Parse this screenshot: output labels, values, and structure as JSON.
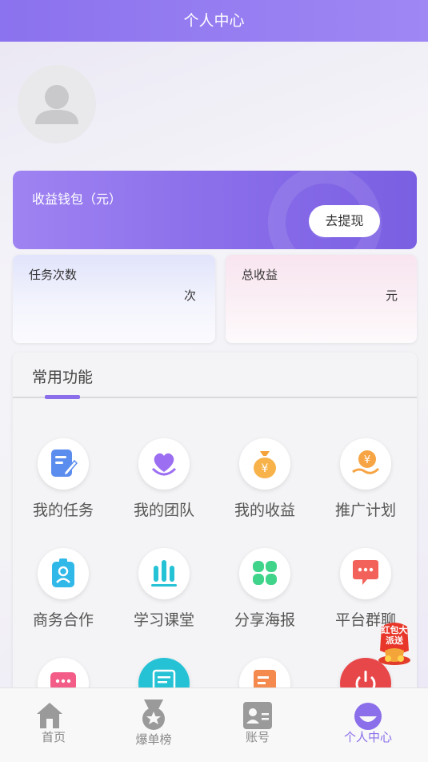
{
  "header": {
    "title": "个人中心"
  },
  "wallet": {
    "label": "收益钱包（元）",
    "withdraw_label": "去提现"
  },
  "stats": {
    "tasks": {
      "label": "任务次数",
      "unit": "次"
    },
    "income": {
      "label": "总收益",
      "unit": "元"
    }
  },
  "functions": {
    "title": "常用功能",
    "items": [
      {
        "label": "我的任务",
        "icon": "task-icon"
      },
      {
        "label": "我的团队",
        "icon": "team-heart-icon"
      },
      {
        "label": "我的收益",
        "icon": "money-bag-icon"
      },
      {
        "label": "推广计划",
        "icon": "promo-coin-icon"
      },
      {
        "label": "商务合作",
        "icon": "badge-icon"
      },
      {
        "label": "学习课堂",
        "icon": "bars-icon"
      },
      {
        "label": "分享海报",
        "icon": "clover-icon"
      },
      {
        "label": "平台群聊",
        "icon": "chat-icon"
      }
    ]
  },
  "floating": {
    "label": "红包大派送"
  },
  "tabbar": {
    "items": [
      {
        "label": "首页",
        "icon": "home-icon"
      },
      {
        "label": "爆单榜",
        "icon": "medal-icon"
      },
      {
        "label": "账号",
        "icon": "id-card-icon"
      },
      {
        "label": "个人中心",
        "icon": "profile-icon"
      }
    ],
    "active_index": 3
  },
  "colors": {
    "accent": "#8a6eea",
    "header": "#8b72ee"
  }
}
